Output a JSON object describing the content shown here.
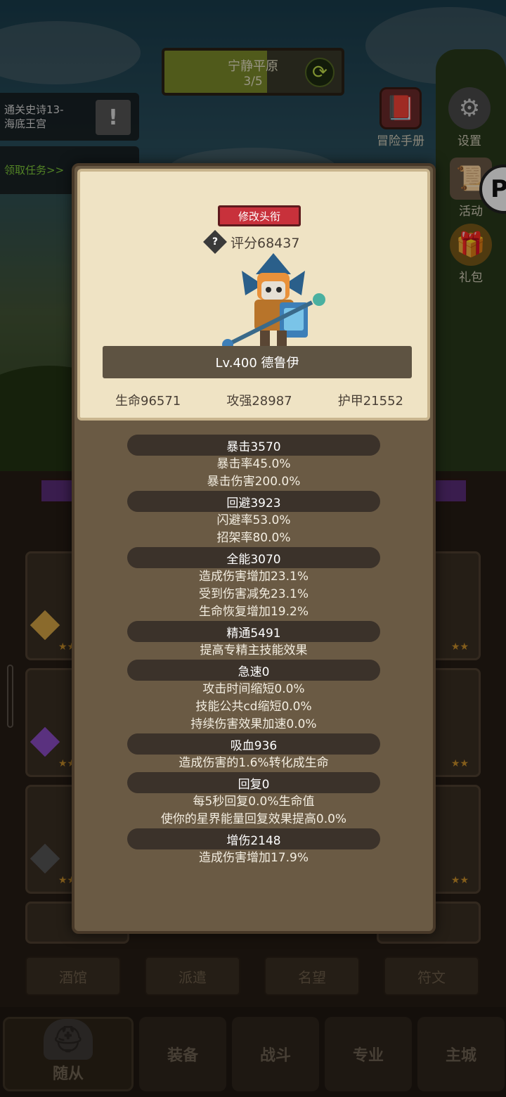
{
  "stage": {
    "name": "宁静平原",
    "progress": "3/5"
  },
  "quests": [
    {
      "text_line1": "通关史诗13-",
      "text_line2": "海底王宫"
    },
    {
      "text_line1": "领取任务>>"
    }
  ],
  "side_icons": {
    "manual": "冒险手册",
    "settings": "设置",
    "activity": "活动",
    "gift": "礼包"
  },
  "popup": {
    "title_button": "修改头衔",
    "score": "评分68437",
    "hero_name": "Lv.400 德鲁伊",
    "base_stats": [
      "生命96571",
      "攻强28987",
      "护甲21552"
    ],
    "stat_groups": [
      {
        "title": "暴击3570",
        "lines": [
          "暴击率45.0%",
          "暴击伤害200.0%"
        ]
      },
      {
        "title": "回避3923",
        "lines": [
          "闪避率53.0%",
          "招架率80.0%"
        ]
      },
      {
        "title": "全能3070",
        "lines": [
          "造成伤害增加23.1%",
          "受到伤害减免23.1%",
          "生命恢复增加19.2%"
        ]
      },
      {
        "title": "精通5491",
        "lines": [
          "提高专精主技能效果"
        ]
      },
      {
        "title": "急速0",
        "lines": [
          "攻击时间缩短0.0%",
          "技能公共cd缩短0.0%",
          "持续伤害效果加速0.0%"
        ]
      },
      {
        "title": "吸血936",
        "lines": [
          "造成伤害的1.6%转化成生命"
        ]
      },
      {
        "title": "回复0",
        "lines": [
          "每5秒回复0.0%生命值",
          "使你的星界能量回复效果提高0.0%"
        ]
      },
      {
        "title": "增伤2148",
        "lines": [
          "造成伤害增加17.9%"
        ]
      }
    ]
  },
  "sub_tabs": [
    "酒馆",
    "派遣",
    "名望",
    "符文"
  ],
  "nav_tabs": [
    "随从",
    "装备",
    "战斗",
    "专业",
    "主城"
  ]
}
